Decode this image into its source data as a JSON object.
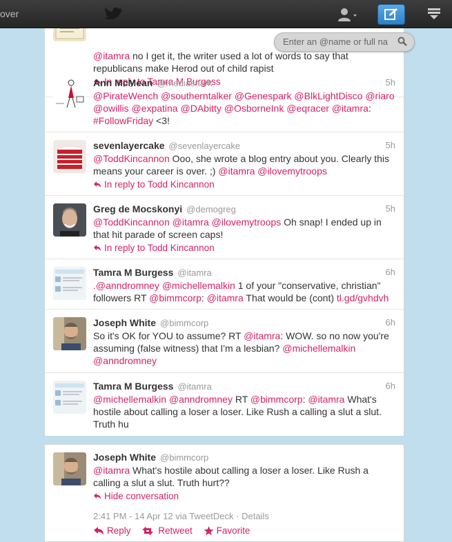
{
  "topbar": {
    "discover_label": "over",
    "colors": {
      "bar": "#2b2b2b",
      "compose": "#3a8fd9"
    }
  },
  "search": {
    "placeholder": "Enter an @name or full na"
  },
  "tweets": [
    {
      "text_parts": [
        "@itamra",
        " no I get it, the writer used a lot of words to say that republicans make Herod out of child rapist"
      ],
      "reply": "In reply to Tamra M Burgess"
    },
    {
      "name": "Ann McMean",
      "handle": "@mediasnark",
      "time": "5h",
      "text_parts": [
        "@PirateWench",
        " ",
        "@southerntalker",
        " ",
        "@Genespark",
        " ",
        "@BlkLightDisco",
        " ",
        "@riaro",
        " ",
        "@owillis",
        " ",
        "@expatina",
        " ",
        "@DAbitty",
        " ",
        "@OsborneInk",
        " ",
        "@eqracer",
        " ",
        "@itamra",
        ": ",
        "#FollowFriday",
        " <3!"
      ]
    },
    {
      "name": "sevenlayercake",
      "handle": "@sevenlayercake",
      "time": "5h",
      "text_parts": [
        "@ToddKincannon",
        " Ooo, she wrote a blog entry about you. Clearly this means your career is over. ;) ",
        "@itamra",
        " ",
        "@ilovemytroops"
      ],
      "reply": "In reply to Todd Kincannon"
    },
    {
      "name": "Greg de Mocskonyi",
      "handle": "@demogreg",
      "time": "5h",
      "text_parts": [
        "@ToddKincannon",
        " ",
        "@itamra",
        " ",
        "@ilovemytroops",
        " Oh snap! I ended up in that hit parade of screen caps!"
      ],
      "reply": "In reply to Todd Kincannon"
    },
    {
      "name": "Tamra M Burgess",
      "handle": "@itamra",
      "time": "6h",
      "text_parts": [
        ".@anndromney",
        " ",
        "@michellemalkin",
        " 1 of your \"conservative, christian\" followers RT ",
        "@bimmcorp",
        ": ",
        "@itamra",
        " That would be (cont) ",
        "tl.gd/gvhdvh"
      ]
    },
    {
      "name": "Joseph White",
      "handle": "@bimmcorp",
      "time": "6h",
      "text_parts": [
        "So it's OK for YOU to assume? RT ",
        "@itamra",
        ": WOW. so no now you're assuming (false witness) that I'm a lesbian? ",
        "@michellemalkin",
        " ",
        "@anndromney"
      ]
    },
    {
      "name": "Tamra M Burgess",
      "handle": "@itamra",
      "time": "6h",
      "text_parts": [
        "@michellemalkin",
        " ",
        "@anndromney",
        " RT ",
        "@bimmcorp",
        ": ",
        "@itamra",
        " What's hostile about calling a loser a loser. Like Rush a calling a slut a slut. Truth hu"
      ]
    }
  ],
  "focused": {
    "name": "Joseph White",
    "handle": "@bimmcorp",
    "text_parts": [
      "@itamra",
      " What's hostile about calling a loser a loser. Like Rush a calling a slut a slut. Truth hurt??"
    ],
    "hide_label": "Hide conversation",
    "timestamp": "2:41 PM - 14 Apr 12 via TweetDeck",
    "separator": " · ",
    "details_label": "Details",
    "actions": {
      "reply": "Reply",
      "retweet": "Retweet",
      "favorite": "Favorite"
    }
  }
}
